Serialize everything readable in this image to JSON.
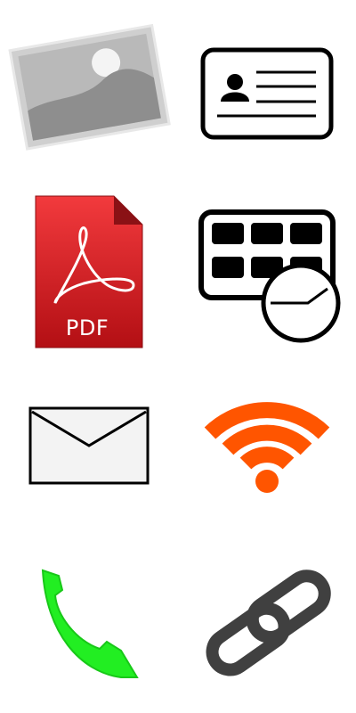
{
  "icons": [
    {
      "name": "image-photo-icon"
    },
    {
      "name": "contact-card-icon"
    },
    {
      "name": "pdf-document-icon",
      "label": "PDF"
    },
    {
      "name": "calendar-clock-icon"
    },
    {
      "name": "mail-envelope-icon"
    },
    {
      "name": "wifi-signal-icon"
    },
    {
      "name": "phone-handset-icon"
    },
    {
      "name": "chain-link-icon"
    }
  ],
  "colors": {
    "pdf_red": "#c8161d",
    "wifi_orange": "#ff5500",
    "phone_green": "#22ee22",
    "outline": "#000000",
    "photo_gray": "#a8a8a8"
  }
}
